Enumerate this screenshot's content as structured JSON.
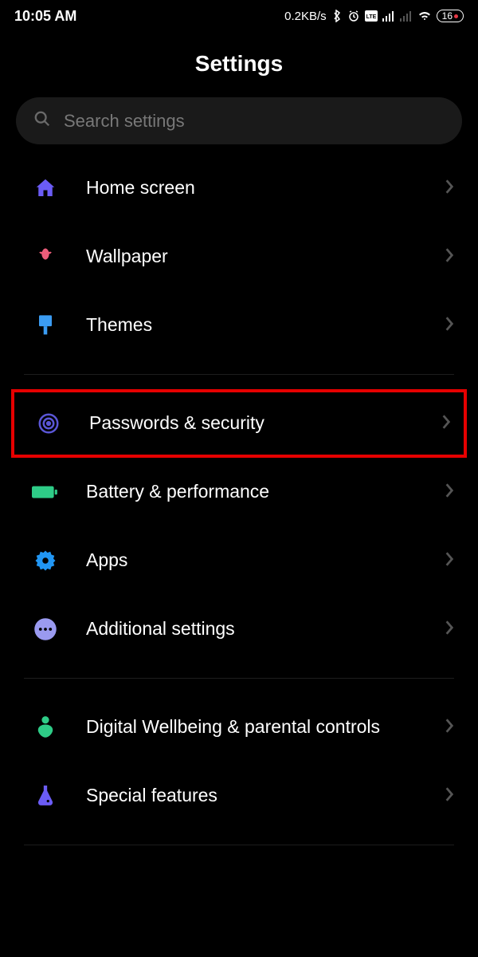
{
  "statusbar": {
    "time": "10:05 AM",
    "data_rate": "0.2KB/s",
    "battery": "16"
  },
  "header": {
    "title": "Settings"
  },
  "search": {
    "placeholder": "Search settings"
  },
  "groups": [
    {
      "items": [
        {
          "key": "home",
          "label": "Home screen",
          "icon": "home-icon",
          "color": "#6b5cf5"
        },
        {
          "key": "wallpaper",
          "label": "Wallpaper",
          "icon": "flower-icon",
          "color": "#ec5d7a"
        },
        {
          "key": "themes",
          "label": "Themes",
          "icon": "brush-icon",
          "color": "#3b9cf2"
        }
      ]
    },
    {
      "items": [
        {
          "key": "passwords",
          "label": "Passwords & security",
          "icon": "fingerprint-icon",
          "color": "#5a56d6",
          "highlight": true
        },
        {
          "key": "battery",
          "label": "Battery & performance",
          "icon": "battery-icon",
          "color": "#2ecc87"
        },
        {
          "key": "apps",
          "label": "Apps",
          "icon": "gear-icon",
          "color": "#2196f3"
        },
        {
          "key": "additional",
          "label": "Additional settings",
          "icon": "dots-icon",
          "color": "#9a9af0"
        }
      ]
    },
    {
      "items": [
        {
          "key": "wellbeing",
          "label": "Digital Wellbeing & parental controls",
          "icon": "heart-icon",
          "color": "#2ecc87"
        },
        {
          "key": "special",
          "label": "Special features",
          "icon": "flask-icon",
          "color": "#6b5cf5"
        }
      ]
    }
  ]
}
